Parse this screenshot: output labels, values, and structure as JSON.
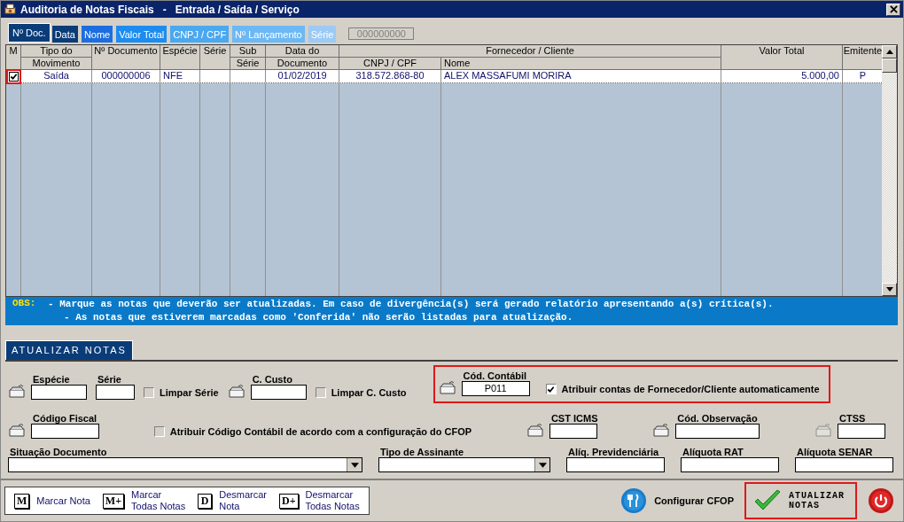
{
  "window": {
    "title": "Auditoria de Notas Fiscais   -   Entrada / Saída / Serviço"
  },
  "sort_tabs": [
    {
      "label": "Nº Doc.",
      "selected": true,
      "color": "#0a3c78"
    },
    {
      "label": "Data",
      "selected": false,
      "color": "#0a3c78"
    },
    {
      "label": "Nome",
      "selected": false,
      "color": "#1c6ee0"
    },
    {
      "label": "Valor Total",
      "selected": false,
      "color": "#1c8cf0"
    },
    {
      "label": "CNPJ / CPF",
      "selected": false,
      "color": "#4aa8f0"
    },
    {
      "label": "Nº Lançamento",
      "selected": false,
      "color": "#6cb8f4"
    },
    {
      "label": "Série",
      "selected": false,
      "color": "#9ccaf4"
    }
  ],
  "search": {
    "value": "000000000"
  },
  "table": {
    "mark_column_header": "M",
    "group_header": "Fornecedor / Cliente",
    "columns": [
      {
        "top": "Tipo do",
        "bottom": "Movimento"
      },
      {
        "top": "Nº Documento"
      },
      {
        "top": "Espécie"
      },
      {
        "top": "Série"
      },
      {
        "top": "Sub",
        "bottom": "Série"
      },
      {
        "top": "Data do",
        "bottom": "Documento"
      },
      {
        "bottom": "CNPJ / CPF"
      },
      {
        "bottom": "Nome"
      },
      {
        "top": "Valor Total"
      },
      {
        "top": "Emitente"
      }
    ],
    "rows": [
      {
        "checked": true,
        "highlighted": true,
        "cells": [
          "Saída",
          "000000006",
          "NFE",
          "",
          "",
          "01/02/2019",
          "318.572.868-80",
          "ALEX MASSAFUMI  MORIRA",
          "5.000,00",
          "P"
        ]
      }
    ]
  },
  "obs": {
    "label": "OBS:",
    "lines": [
      "- Marque as notas que deverão ser atualizadas. Em caso de divergência(s) será gerado relatório apresentando a(s) crítica(s).",
      "- As notas que estiverem marcadas como 'Conferida' não serão listadas para atualização."
    ]
  },
  "section_tab": "ATUALIZAR NOTAS",
  "form": {
    "rows": [
      {
        "fields": [
          {
            "kind": "lookup",
            "label": "Espécie"
          },
          {
            "kind": "field",
            "label": "Série"
          },
          {
            "kind": "checkbox",
            "label": "Limpar Série",
            "checked": false
          },
          {
            "kind": "lookup",
            "label": "C. Custo"
          },
          {
            "kind": "checkbox",
            "label": "Limpar C. Custo",
            "checked": false
          },
          {
            "kind": "group",
            "highlighted": true,
            "items": [
              {
                "kind": "lookup",
                "label": "Cód. Contábil",
                "value": "P011"
              },
              {
                "kind": "checkbox",
                "label": "Atribuir contas de Fornecedor/Cliente automaticamente",
                "checked": true
              }
            ]
          }
        ]
      },
      {
        "fields": [
          {
            "kind": "lookup",
            "label": "Código Fiscal"
          },
          {
            "kind": "checkbox",
            "label": "Atribuir Código Contábil de acordo com a configuração do CFOP",
            "checked": false
          },
          {
            "kind": "lookup",
            "label": "CST ICMS"
          },
          {
            "kind": "lookup",
            "label": "Cód. Observação"
          },
          {
            "kind": "lookup",
            "label": "CTSS",
            "disabled": true
          }
        ]
      },
      {
        "fields": [
          {
            "kind": "select",
            "label": "Situação Documento"
          },
          {
            "kind": "select",
            "label": "Tipo de Assinante"
          },
          {
            "kind": "field",
            "label": "Alíq. Previdenciária"
          },
          {
            "kind": "field",
            "label": "Alíquota RAT"
          },
          {
            "kind": "field",
            "label": "Alíquota SENAR"
          }
        ]
      }
    ]
  },
  "mark_buttons": [
    {
      "key": "M",
      "label": "Marcar Nota"
    },
    {
      "key": "M+",
      "label": "Marcar\nTodas Notas"
    },
    {
      "key": "D",
      "label": "Desmarcar\nNota"
    },
    {
      "key": "D+",
      "label": "Desmarcar\nTodas Notas"
    }
  ],
  "configure_button": "Configurar CFOP",
  "update_button": {
    "label": "ATUALIZAR\nNOTAS",
    "highlighted": true
  }
}
